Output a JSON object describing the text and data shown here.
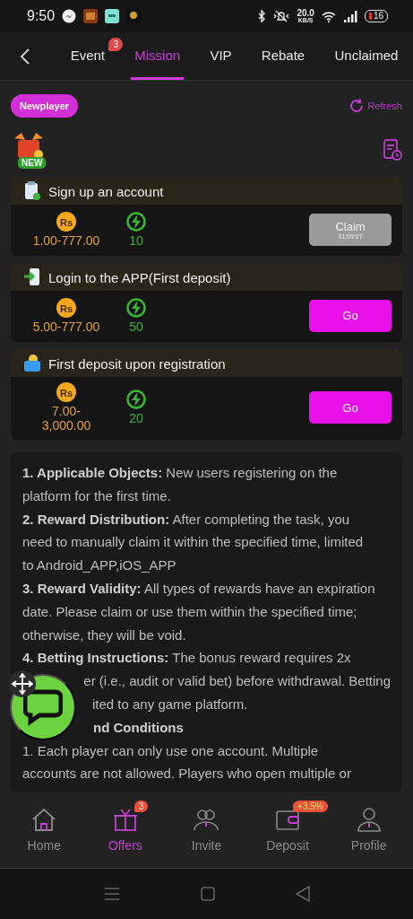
{
  "status_bar": {
    "time": "9:50",
    "net_speed": "20.0",
    "net_unit": "KB/S",
    "battery": "16"
  },
  "tabs": [
    {
      "label": "Event",
      "selected": false,
      "badge": "3"
    },
    {
      "label": "Mission",
      "selected": true
    },
    {
      "label": "VIP",
      "selected": false
    },
    {
      "label": "Rebate",
      "selected": false
    },
    {
      "label": "Unclaimed",
      "selected": false
    }
  ],
  "filters": [
    {
      "label": "Newplayer",
      "selected": true
    }
  ],
  "refresh": {
    "label": "Refresh"
  },
  "new_badge": "NEW",
  "tasks": [
    {
      "title": "Sign up an account",
      "currency": "Rs",
      "reward": "1.00-777.00",
      "points": "10",
      "action": {
        "kind": "claim",
        "label": "Claim",
        "timer": "01:09:07",
        "disabled": true
      }
    },
    {
      "title": "Login to the APP(First deposit)",
      "currency": "Rs",
      "reward": "5.00-777.00",
      "points": "50",
      "action": {
        "kind": "go",
        "label": "Go",
        "disabled": false
      }
    },
    {
      "title": "First deposit upon registration",
      "currency": "Rs",
      "reward": "7.00-3,000.00",
      "points": "20",
      "action": {
        "kind": "go",
        "label": "Go",
        "disabled": false
      }
    }
  ],
  "rules": [
    {
      "kind": "full",
      "text": "**1. Applicable Objects:** New users registering on the"
    },
    {
      "kind": "full",
      "text": "platform for the first time."
    },
    {
      "kind": "full",
      "text": "**2. Reward Distribution:** After completing the task, you"
    },
    {
      "kind": "full",
      "text": "need to manually claim it within the specified time, limited"
    },
    {
      "kind": "full",
      "text": "to Android_APP,iOS_APP"
    },
    {
      "kind": "full",
      "text": "**3. Reward Validity:** All types of rewards have an expiration"
    },
    {
      "kind": "full",
      "text": "date. Please claim or use them within the specified time;"
    },
    {
      "kind": "full",
      "text": "otherwise, they will be void."
    },
    {
      "kind": "full",
      "text": "**4. Betting Instructions:** The bonus reward requires 2x"
    },
    {
      "kind": "partial",
      "text": "er (i.e., audit or valid bet) before withdrawal. Betting"
    },
    {
      "kind": "partial",
      "text": "ited to any game platform."
    },
    {
      "kind": "partial",
      "text": "**nd Conditions**"
    },
    {
      "kind": "full",
      "text": "1. Each player can only use one account. Multiple"
    },
    {
      "kind": "full",
      "text": "accounts are not allowed. Players who open multiple or"
    }
  ],
  "nav": [
    {
      "label": "Home",
      "selected": false
    },
    {
      "label": "Offers",
      "selected": true,
      "badge": "3"
    },
    {
      "label": "Invite",
      "selected": false
    },
    {
      "label": "Deposit",
      "selected": false,
      "badge": "+3.5%"
    },
    {
      "label": "Profile",
      "selected": false
    }
  ]
}
